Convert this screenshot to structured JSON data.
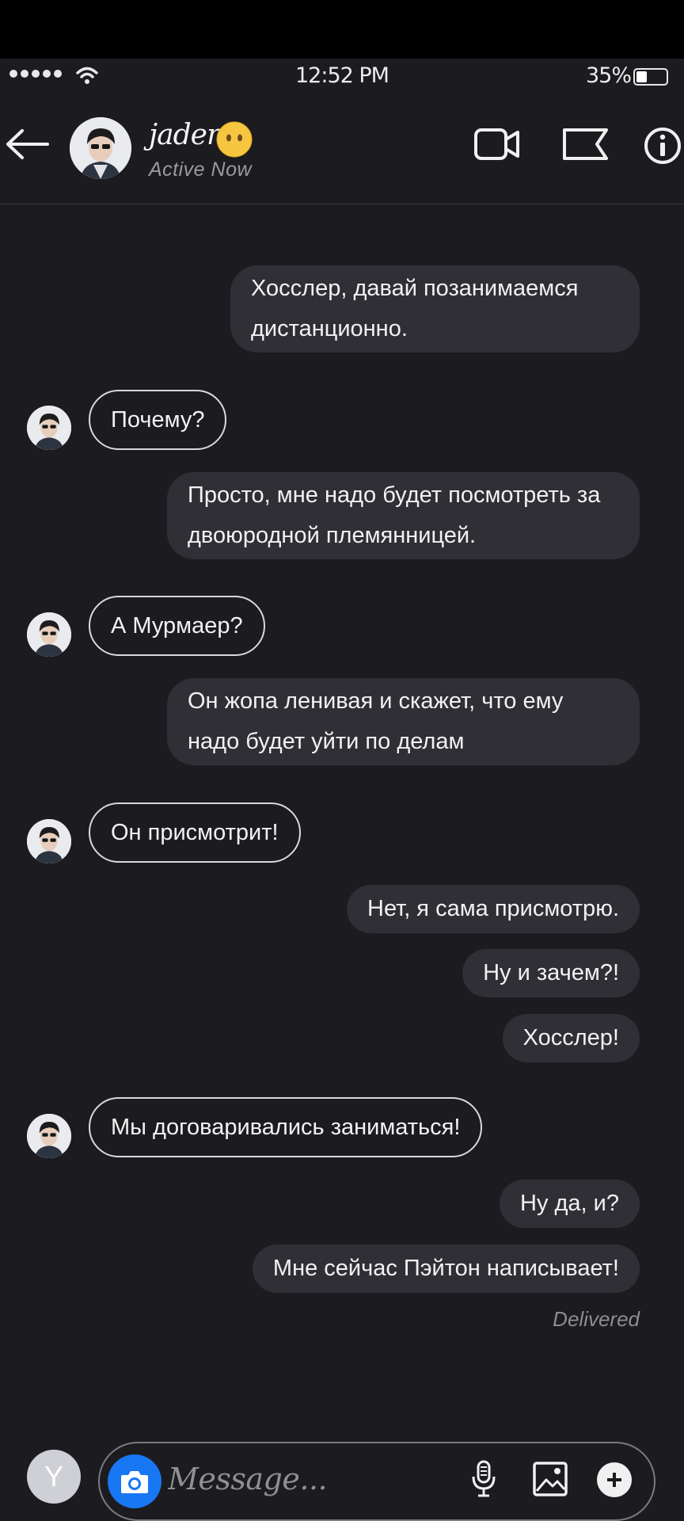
{
  "status_bar": {
    "time": "12:52 PM",
    "battery_percent": "35%",
    "battery_level": 0.35,
    "signal_bars": 5
  },
  "header": {
    "contact_name": "jaden",
    "contact_emoji": "face-without-mouth-emoji",
    "contact_status": "Active Now",
    "icons": [
      "back-arrow-icon",
      "video-call-icon",
      "flag-icon",
      "info-icon"
    ]
  },
  "messages": [
    {
      "sender": "me",
      "text": "Хосслер, давай позанимаемся дистанционно."
    },
    {
      "sender": "them",
      "text": "Почему?"
    },
    {
      "sender": "me",
      "text": "Просто, мне надо будет посмотреть за двоюродной племянницей."
    },
    {
      "sender": "them",
      "text": "А Мурмаер?"
    },
    {
      "sender": "me",
      "text": "Он жопа ленивая и скажет, что ему надо будет уйти по делам"
    },
    {
      "sender": "them",
      "text": "Он присмотрит!"
    },
    {
      "sender": "me",
      "text": "Нет, я сама присмотрю."
    },
    {
      "sender": "me",
      "text": "Ну и зачем?!"
    },
    {
      "sender": "me",
      "text": "Хосслер!"
    },
    {
      "sender": "them",
      "text": "Мы договаривались заниматься!"
    },
    {
      "sender": "me",
      "text": "Ну да, и?"
    },
    {
      "sender": "me",
      "text": "Мне сейчас Пэйтон написывает!"
    }
  ],
  "delivered_label": "Delivered",
  "composer": {
    "user_initial": "Y",
    "placeholder": "Message...",
    "icons": [
      "camera-icon",
      "microphone-icon",
      "gallery-icon",
      "plus-icon"
    ]
  },
  "colors": {
    "background": "#1c1b1f",
    "sent_bubble": "#302f35",
    "received_border": "#d9d9d9",
    "camera_button": "#1877f2"
  }
}
